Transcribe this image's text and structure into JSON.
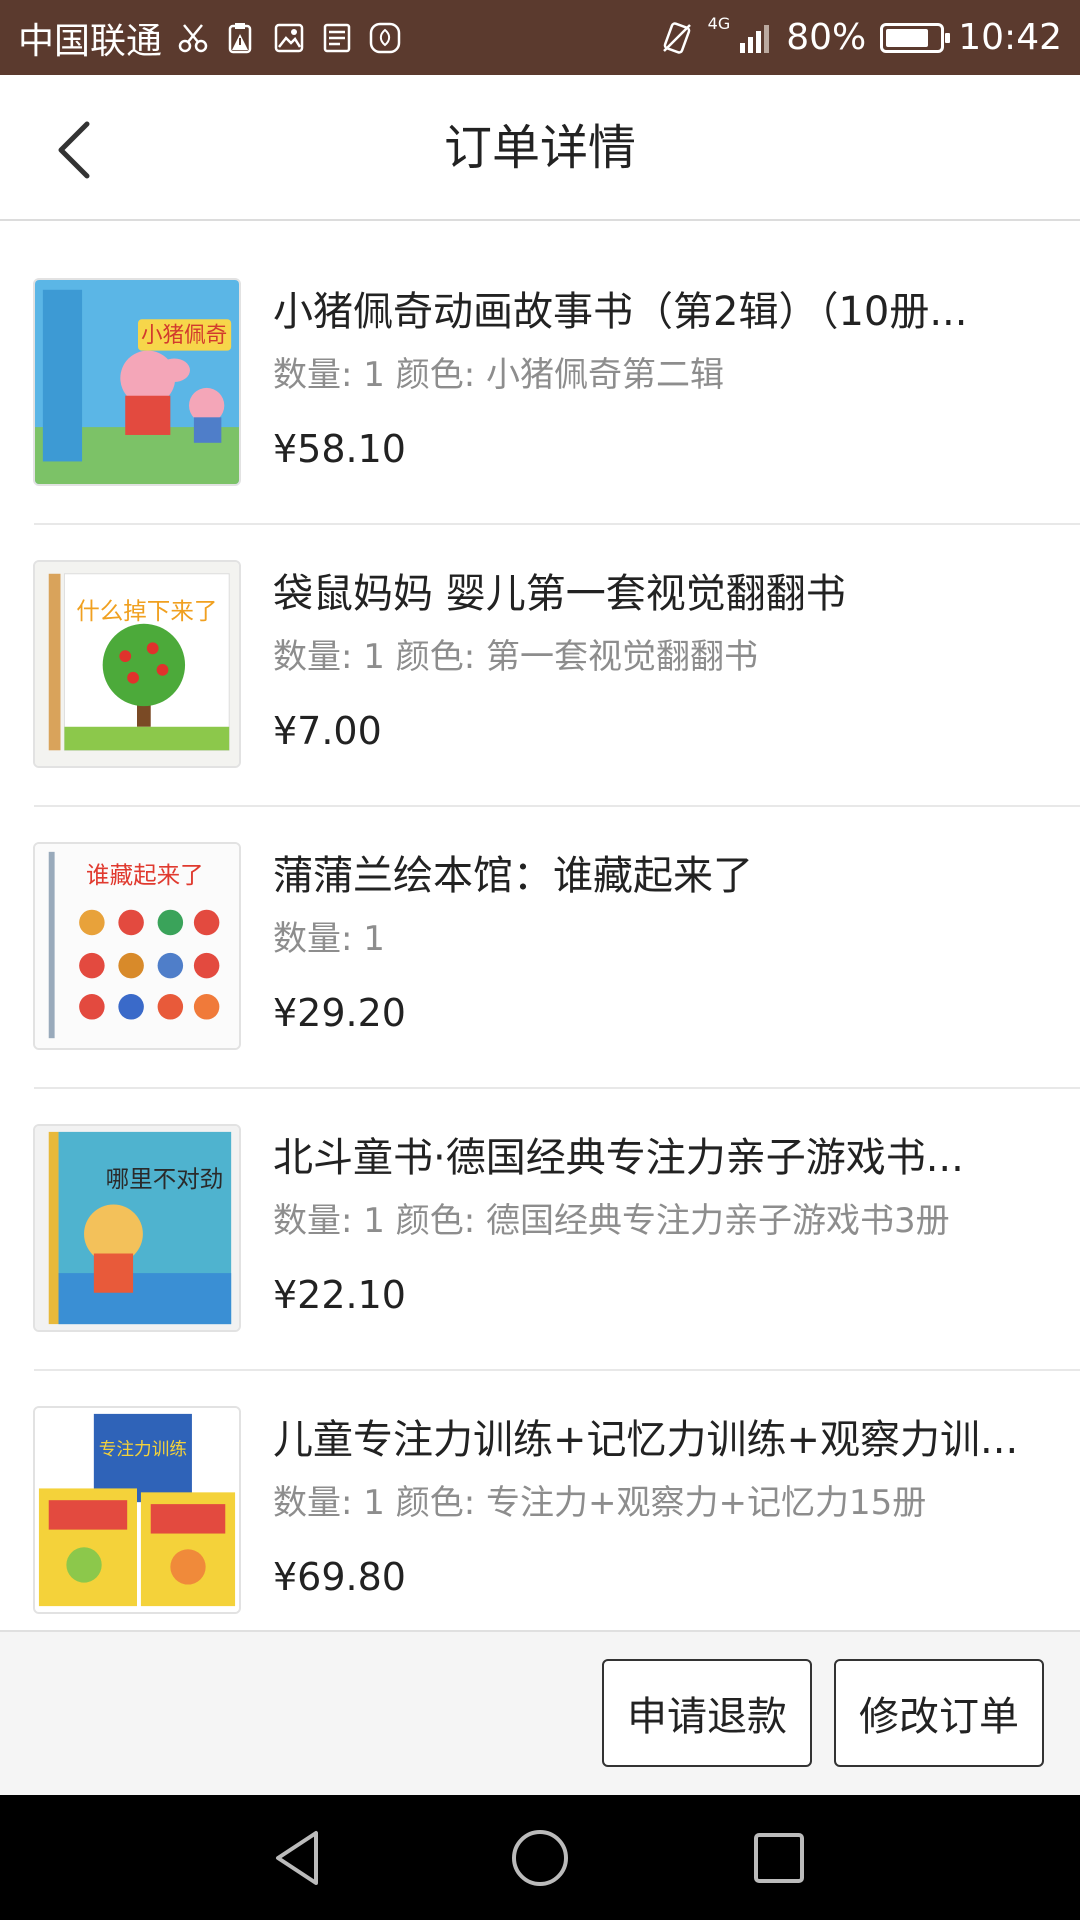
{
  "status_bar": {
    "carrier": "中国联通",
    "network": "4G",
    "battery_text": "80%",
    "battery_level": 0.8,
    "time": "10:42",
    "icons": [
      "scissors-icon",
      "warning-clipboard-icon",
      "image-icon",
      "news-icon",
      "huawei-icon",
      "no-sim-icon",
      "signal-icon",
      "battery-icon"
    ]
  },
  "header": {
    "title": "订单详情",
    "back_icon": "chevron-left-icon"
  },
  "items": [
    {
      "title": "小猪佩奇动画故事书（第2辑）（10册...",
      "meta": "数量: 1 颜色: 小猪佩奇第二辑",
      "price": "¥58.10",
      "cover_text": "小猪佩奇",
      "cover_color": "#5bb6e6"
    },
    {
      "title": "袋鼠妈妈 婴儿第一套视觉翻翻书",
      "meta": "数量: 1 颜色: 第一套视觉翻翻书",
      "price": "¥7.00",
      "cover_text": "什么掉下来了",
      "cover_color": "#f3f3f0"
    },
    {
      "title": "蒲蒲兰绘本馆：谁藏起来了",
      "meta": "数量: 1",
      "price": "¥29.20",
      "cover_text": "谁藏起来了",
      "cover_color": "#fbfbfb"
    },
    {
      "title": "北斗童书·德国经典专注力亲子游戏书...",
      "meta": "数量: 1 颜色: 德国经典专注力亲子游戏书3册",
      "price": "¥22.10",
      "cover_text": "哪里不对劲",
      "cover_color": "#4fb3cf"
    },
    {
      "title": "儿童专注力训练+记忆力训练+观察力训...",
      "meta": "数量: 1 颜色: 专注力+观察力+记忆力15册",
      "price": "¥69.80",
      "cover_text": "专注力训练",
      "cover_color": "#f4d23a"
    }
  ],
  "actions": {
    "refund": "申请退款",
    "modify": "修改订单"
  },
  "nav": {
    "back": "triangle-back-icon",
    "home": "circle-home-icon",
    "recent": "square-recent-icon"
  }
}
